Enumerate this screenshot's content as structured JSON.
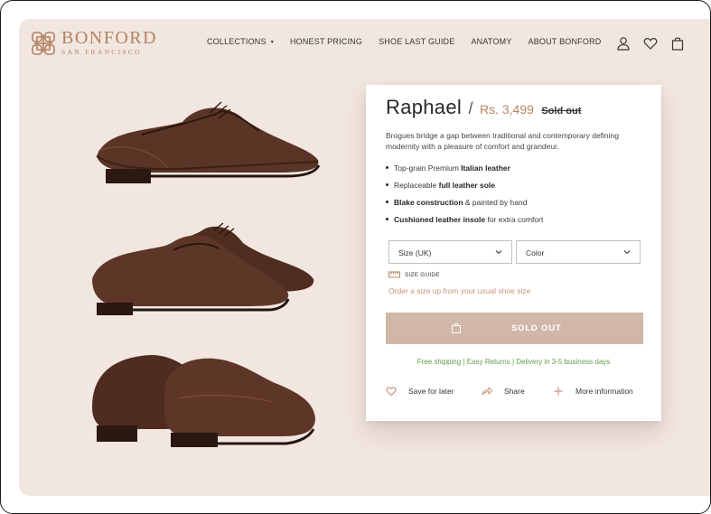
{
  "brand": {
    "name": "BONFORD",
    "tagline": "SAN FRANCISCO",
    "color": "#b48262"
  },
  "nav": {
    "items": [
      {
        "label": "COLLECTIONS",
        "caret": "▾"
      },
      {
        "label": "HONEST PRICING"
      },
      {
        "label": "SHOE LAST GUIDE"
      },
      {
        "label": "ANATOMY"
      },
      {
        "label": "ABOUT BONFORD"
      }
    ],
    "icons": [
      "user-icon",
      "heart-icon",
      "shopping-bag-icon"
    ]
  },
  "gallery": {
    "images": [
      "shoe-side-view",
      "shoe-pair-front-view",
      "shoe-pair-rear-view"
    ]
  },
  "product": {
    "name": "Raphael",
    "separator": "/",
    "price": "Rs. 3,499",
    "status": "Sold out",
    "description": "Brogues bridge a gap between traditional and contemporary defining modernity with a pleasure of comfort and grandeur.",
    "features": [
      {
        "before": "Top-grain Premium ",
        "bold": "Italian leather",
        "after": ""
      },
      {
        "before": "Replaceable ",
        "bold": "full leather sole",
        "after": ""
      },
      {
        "before": "",
        "bold": "Blake construction",
        "after": " & painted by hand"
      },
      {
        "before": "",
        "bold": "Cushioned leather insole",
        "after": " for extra comfort"
      }
    ],
    "size_select": {
      "value": "Size (UK)"
    },
    "color_select": {
      "value": "Color"
    },
    "size_guide_label": "SIZE GUIDE",
    "size_note": "Order a size up from your usual shoe size",
    "button_label": "SOLD OUT",
    "shipping_note": "Free shipping | Easy Returns | Delivery in 3-5 business days",
    "actions": {
      "save": "Save for later",
      "share": "Share",
      "more": "More information"
    }
  },
  "colors": {
    "page_bg": "#f2e6e0",
    "accent": "#b98463",
    "button_bg": "#d1b7a7",
    "shipping_text": "#5f9e49"
  }
}
